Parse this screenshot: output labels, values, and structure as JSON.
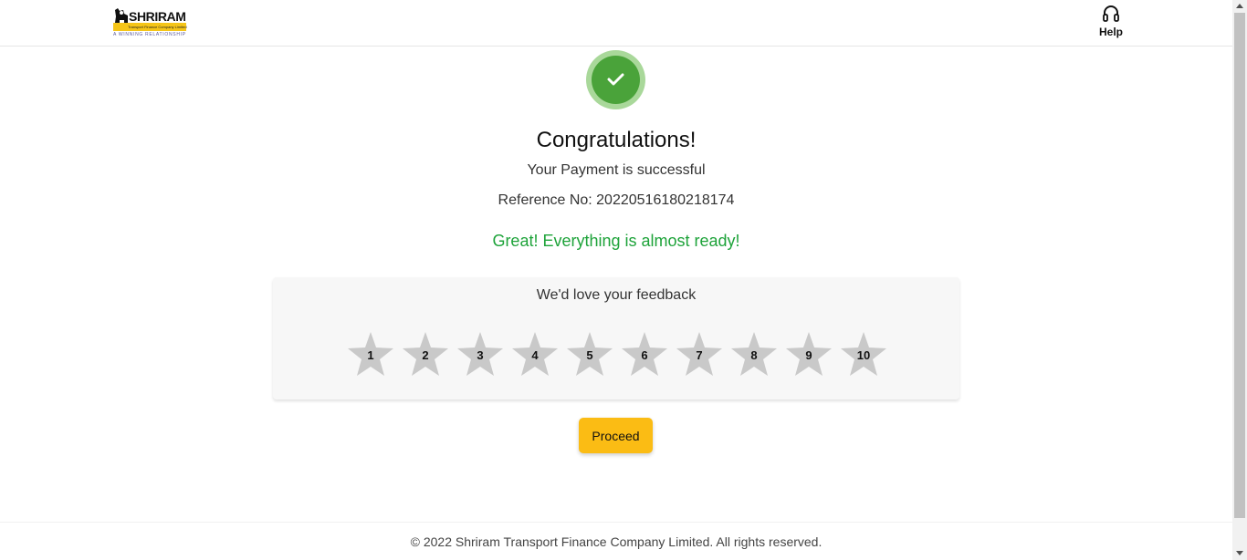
{
  "header": {
    "logo": {
      "brand": "SHRIRAM",
      "subtitle": "Transport Finance Company Limited",
      "tagline": "A WINNING RELATIONSHIP",
      "bar_color": "#f5c518"
    },
    "help": {
      "icon": "headset-icon",
      "label": "Help"
    }
  },
  "success": {
    "icon": "check-icon",
    "ring_color": "#a9d89a",
    "fill_color": "#4aa33a",
    "title": "Congratulations!",
    "payment_text": "Your Payment is successful",
    "reference": "Reference No: 20220516180218174",
    "ready_text": "Great! Everything is almost ready!",
    "ready_color": "#1ea33a"
  },
  "feedback": {
    "title": "We'd love your feedback",
    "star_color": "#c9c9c9",
    "stars": [
      "1",
      "2",
      "3",
      "4",
      "5",
      "6",
      "7",
      "8",
      "9",
      "10"
    ]
  },
  "actions": {
    "proceed_label": "Proceed",
    "proceed_color": "#fbbc14"
  },
  "footer": {
    "copyright": "© 2022 Shriram Transport Finance Company Limited. All rights reserved."
  }
}
